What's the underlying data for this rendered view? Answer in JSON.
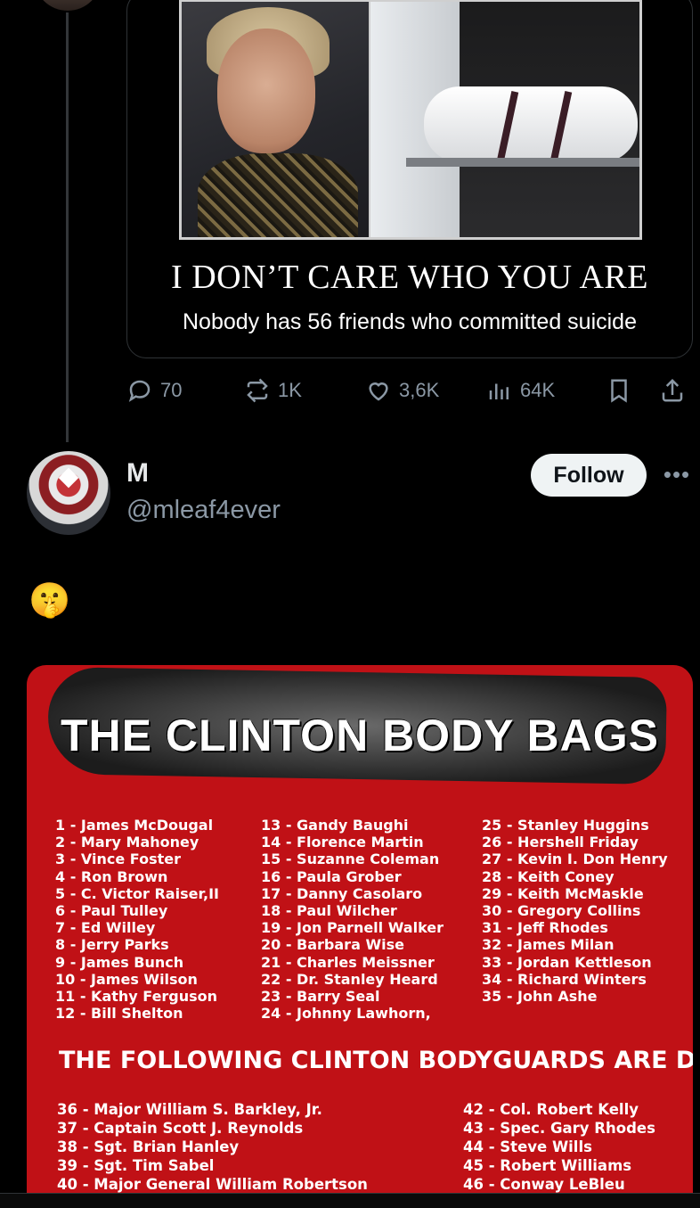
{
  "quoted_post": {
    "meme_title": "I DON’T CARE WHO YOU ARE",
    "meme_subtitle": "Nobody has 56 friends who committed suicide"
  },
  "actions": {
    "replies": "70",
    "reposts": "1K",
    "likes": "3,6K",
    "views": "64K"
  },
  "reply": {
    "name": "M",
    "handle": "@mleaf4ever",
    "follow_label": "Follow",
    "more_label": "•••",
    "text": "🤫"
  },
  "media": {
    "title": "THE CLINTON BODY BAGS",
    "column1": [
      "1 - James McDougal",
      "2 - Mary Mahoney",
      "3 - Vince Foster",
      "4 - Ron Brown",
      "5 - C. Victor Raiser,II",
      "6 - Paul Tulley",
      "7 - Ed Willey",
      "8 - Jerry Parks",
      "9 - James Bunch",
      "10 - James Wilson",
      "11 - Kathy Ferguson",
      "12 - Bill Shelton"
    ],
    "column2": [
      "13 - Gandy Baughi",
      "14 - Florence Martin",
      "15 - Suzanne Coleman",
      "16 - Paula Grober",
      "17 - Danny Casolaro",
      "18 - Paul Wilcher",
      "19 - Jon Parnell Walker",
      "20 - Barbara Wise",
      "21 - Charles Meissner",
      "22 - Dr. Stanley Heard",
      "23 - Barry Seal",
      "24 - Johnny Lawhorn,"
    ],
    "column3": [
      "25 - Stanley Huggins",
      "26 - Hershell Friday",
      "27 - Kevin I. Don Henry",
      "28 - Keith Coney",
      "29 - Keith McMaskle",
      "30 - Gregory Collins",
      "31 - Jeff Rhodes",
      "32 - James Milan",
      "33 - Jordan Kettleson",
      "34 - Richard Winters",
      "35 - John Ashe"
    ],
    "guards_heading": "THE FOLLOWING CLINTON BODYGUARDS ARE DEAD:",
    "guards_col1": [
      "36 - Major William S. Barkley, Jr.",
      "37 - Captain Scott J. Reynolds",
      "38 - Sgt. Brian Hanley",
      "39 - Sgt. Tim Sabel",
      "40 - Major General William Robertson"
    ],
    "guards_col2": [
      "42 - Col. Robert Kelly",
      "43 - Spec. Gary Rhodes",
      "44 - Steve Wills",
      "45 - Robert Williams",
      "46 - Conway LeBleu"
    ]
  }
}
